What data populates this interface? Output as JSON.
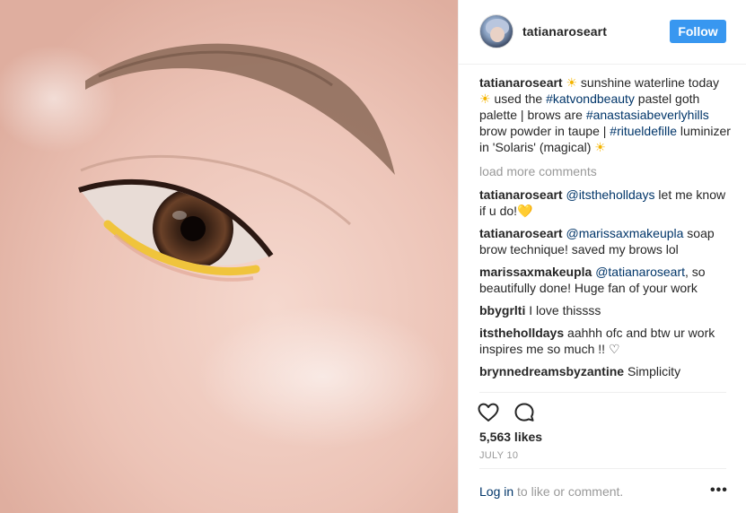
{
  "post": {
    "author": "tatianaroseart",
    "follow_label": "Follow",
    "caption": {
      "user": "tatianaroseart",
      "sun1": "☀",
      "t1": " sunshine waterline today ",
      "sun2": "☀",
      "t2": " used the ",
      "tag1": "#katvondbeauty",
      "t3": " pastel goth palette | brows are ",
      "tag2": "#anastasiabeverlyhills",
      "t4": " brow powder in taupe | ",
      "tag3": "#ritueldefille",
      "t5": " luminizer in 'Solaris' (magical) ",
      "sun3": "☀"
    },
    "load_more": "load more comments",
    "comments": [
      {
        "user": "tatianaroseart",
        "mention": "@itstheholldays",
        "text": " let me know if u do!",
        "emoji": "💛"
      },
      {
        "user": "tatianaroseart",
        "mention": "@marissaxmakeupla",
        "text": " soap brow technique! saved my brows lol"
      },
      {
        "user": "marissaxmakeupla",
        "mention": "@tatianaroseart",
        "text": ", so beautifully done! Huge fan of your work"
      },
      {
        "user": "bbygrlti",
        "text": " I love thissss"
      },
      {
        "user": "itstheholldays",
        "text": " aahhh ofc and btw ur work inspires me so much !! ♡"
      },
      {
        "user": "brynnedreamsbyzantine",
        "text": " Simplicity"
      }
    ],
    "likes": "5,563 likes",
    "date": "JULY 10",
    "login_link": "Log in",
    "login_rest": " to like or comment.",
    "more_label": "•••"
  },
  "icons": {
    "like": "heart-outline-icon",
    "comment": "speech-bubble-icon",
    "more": "more-dots-icon"
  },
  "colors": {
    "accent": "#3897f0",
    "link": "#003569",
    "muted": "#999999",
    "text": "#262626"
  }
}
